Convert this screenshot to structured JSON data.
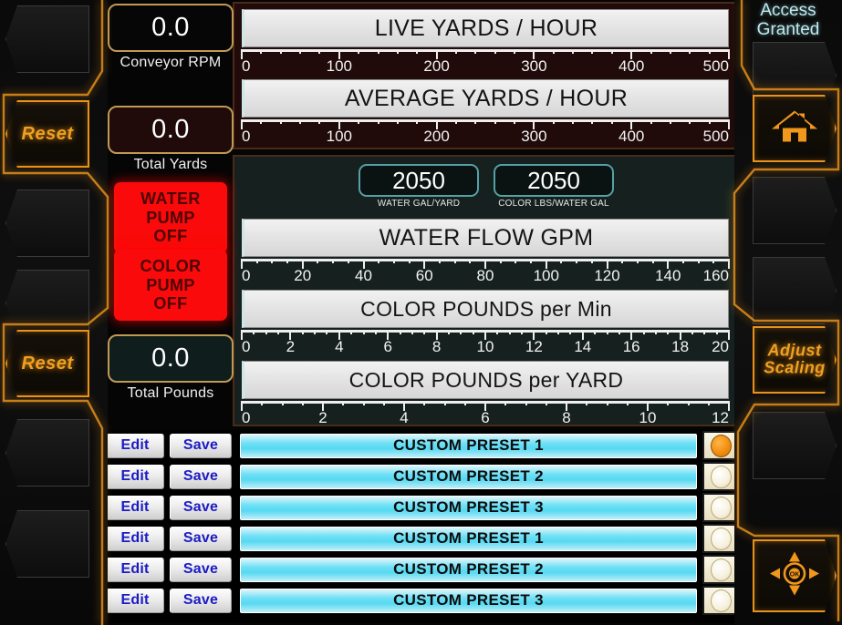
{
  "status": {
    "access_line1": "Access",
    "access_line2": "Granted"
  },
  "left_bezel": {
    "reset_top": "Reset",
    "reset_bottom": "Reset"
  },
  "right_bezel": {
    "home_icon": "home-icon",
    "adjust_line1": "Adjust",
    "adjust_line2": "Scaling",
    "nav_icon": "dpad-ok-icon",
    "nav_ok_label": "OK"
  },
  "readouts": [
    {
      "value": "0.0",
      "label": "Conveyor RPM"
    },
    {
      "value": "0.0",
      "label": "Total Yards"
    },
    {
      "value": "0.0",
      "label": "Total Pounds"
    }
  ],
  "pumps": [
    {
      "line1": "WATER",
      "line2": "PUMP",
      "line3": "OFF",
      "color": "#fa0a0a"
    },
    {
      "line1": "COLOR",
      "line2": "PUMP",
      "line3": "OFF",
      "color": "#fa0a0a"
    }
  ],
  "setpoints": [
    {
      "value": "2050",
      "label": "WATER GAL/YARD"
    },
    {
      "value": "2050",
      "label": "COLOR LBS/WATER GAL"
    }
  ],
  "chart_data": [
    {
      "type": "bar",
      "title": "LIVE YARDS / HOUR",
      "categories": [
        "LIVE YARDS / HOUR"
      ],
      "values": [
        0
      ],
      "xlabel": "",
      "ylabel": "",
      "ylim": [
        0,
        500
      ],
      "ticks": [
        0,
        100,
        200,
        300,
        400,
        500
      ],
      "minor_step": 20,
      "grid": false,
      "legend": "none"
    },
    {
      "type": "bar",
      "title": "AVERAGE YARDS / HOUR",
      "categories": [
        "AVERAGE YARDS / HOUR"
      ],
      "values": [
        0
      ],
      "xlabel": "",
      "ylabel": "",
      "ylim": [
        0,
        500
      ],
      "ticks": [
        0,
        100,
        200,
        300,
        400,
        500
      ],
      "minor_step": 20,
      "grid": false,
      "legend": "none"
    },
    {
      "type": "bar",
      "title": "WATER FLOW GPM",
      "categories": [
        "WATER FLOW GPM"
      ],
      "values": [
        0
      ],
      "xlabel": "",
      "ylabel": "",
      "ylim": [
        0,
        160
      ],
      "ticks": [
        0,
        20,
        40,
        60,
        80,
        100,
        120,
        140,
        160
      ],
      "minor_step": 5,
      "grid": false,
      "legend": "none"
    },
    {
      "type": "bar",
      "title": "COLOR POUNDS per Min",
      "categories": [
        "COLOR POUNDS per Min"
      ],
      "values": [
        0
      ],
      "xlabel": "",
      "ylabel": "",
      "ylim": [
        0,
        20
      ],
      "ticks": [
        0,
        2,
        4,
        6,
        8,
        10,
        12,
        14,
        16,
        18,
        20
      ],
      "minor_step": 0.5,
      "grid": false,
      "legend": "none"
    },
    {
      "type": "bar",
      "title": "COLOR POUNDS per YARD",
      "categories": [
        "COLOR POUNDS per YARD"
      ],
      "values": [
        0
      ],
      "xlabel": "",
      "ylabel": "",
      "ylim": [
        0,
        12
      ],
      "ticks": [
        0,
        2,
        4,
        6,
        8,
        10,
        12
      ],
      "minor_step": 0.5,
      "grid": false,
      "legend": "none"
    }
  ],
  "gauges": [
    {
      "title": "LIVE YARDS / HOUR",
      "min": 0,
      "max": 500,
      "value": 0,
      "ticks": [
        "0",
        "100",
        "200",
        "300",
        "400",
        "500"
      ],
      "minor_per": 5
    },
    {
      "title": "AVERAGE YARDS / HOUR",
      "min": 0,
      "max": 500,
      "value": 0,
      "ticks": [
        "0",
        "100",
        "200",
        "300",
        "400",
        "500"
      ],
      "minor_per": 5
    },
    {
      "title": "WATER FLOW GPM",
      "min": 0,
      "max": 160,
      "value": 0,
      "ticks": [
        "0",
        "20",
        "40",
        "60",
        "80",
        "100",
        "120",
        "140",
        "160"
      ],
      "minor_per": 4
    },
    {
      "title": "COLOR POUNDS per Min",
      "min": 0,
      "max": 20,
      "value": 0,
      "ticks": [
        "0",
        "2",
        "4",
        "6",
        "8",
        "10",
        "12",
        "14",
        "16",
        "18",
        "20"
      ],
      "minor_per": 4
    },
    {
      "title": "COLOR POUNDS per YARD",
      "min": 0,
      "max": 12,
      "value": 0,
      "ticks": [
        "0",
        "2",
        "4",
        "6",
        "8",
        "10",
        "12"
      ],
      "minor_per": 4
    }
  ],
  "presets": {
    "edit_label": "Edit",
    "save_label": "Save",
    "rows": [
      {
        "name": "CUSTOM PRESET 1",
        "selected": true
      },
      {
        "name": "CUSTOM PRESET 2",
        "selected": false
      },
      {
        "name": "CUSTOM PRESET 3",
        "selected": false
      },
      {
        "name": "CUSTOM PRESET 1",
        "selected": false
      },
      {
        "name": "CUSTOM PRESET 2",
        "selected": false
      },
      {
        "name": "CUSTOM PRESET 3",
        "selected": false
      }
    ]
  },
  "colors": {
    "accent_orange": "#f0a020",
    "status_cyan": "#bfe9ec",
    "alarm_red": "#fa0a0a",
    "preset_cyan": "#57d9f2",
    "button_blue": "#1b1bc4",
    "panel_maroon": "#200a0a",
    "panel_teal": "#16211f",
    "box_gold": "#c09a52",
    "setbox_teal": "#55a0a4"
  }
}
